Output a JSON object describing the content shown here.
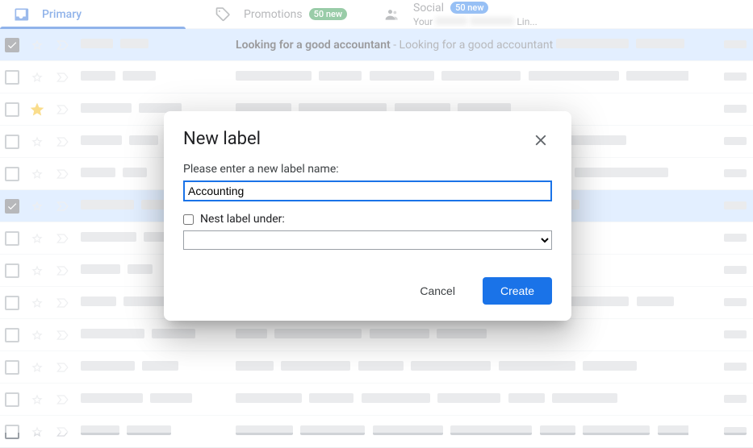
{
  "tabs": {
    "primary": {
      "label": "Primary"
    },
    "promotions": {
      "label": "Promotions",
      "badge": "50 new"
    },
    "social": {
      "label": "Social",
      "badge": "50 new",
      "sub_prefix": "Your",
      "sub_suffix": "Lin..."
    }
  },
  "visible_email": {
    "subject": "Looking for a good accountant",
    "preview_sep": " - ",
    "preview": "Looking for a good accountant"
  },
  "rows": [
    {
      "checked": true,
      "starred": false,
      "visible": true
    },
    {
      "checked": false,
      "starred": false,
      "visible": false
    },
    {
      "checked": false,
      "starred": true,
      "visible": false
    },
    {
      "checked": false,
      "starred": false,
      "visible": false
    },
    {
      "checked": false,
      "starred": false,
      "visible": false
    },
    {
      "checked": true,
      "starred": false,
      "visible": false,
      "highlight": true
    },
    {
      "checked": false,
      "starred": false,
      "visible": false
    },
    {
      "checked": false,
      "starred": false,
      "visible": false
    },
    {
      "checked": false,
      "starred": false,
      "visible": false
    },
    {
      "checked": false,
      "starred": false,
      "visible": false
    },
    {
      "checked": false,
      "starred": false,
      "visible": false
    },
    {
      "checked": false,
      "starred": false,
      "visible": false
    },
    {
      "checked": false,
      "starred": false,
      "visible": false
    }
  ],
  "dialog": {
    "title": "New label",
    "name_prompt": "Please enter a new label name:",
    "name_value": "Accounting",
    "nest_label": "Nest label under:",
    "cancel": "Cancel",
    "create": "Create"
  }
}
